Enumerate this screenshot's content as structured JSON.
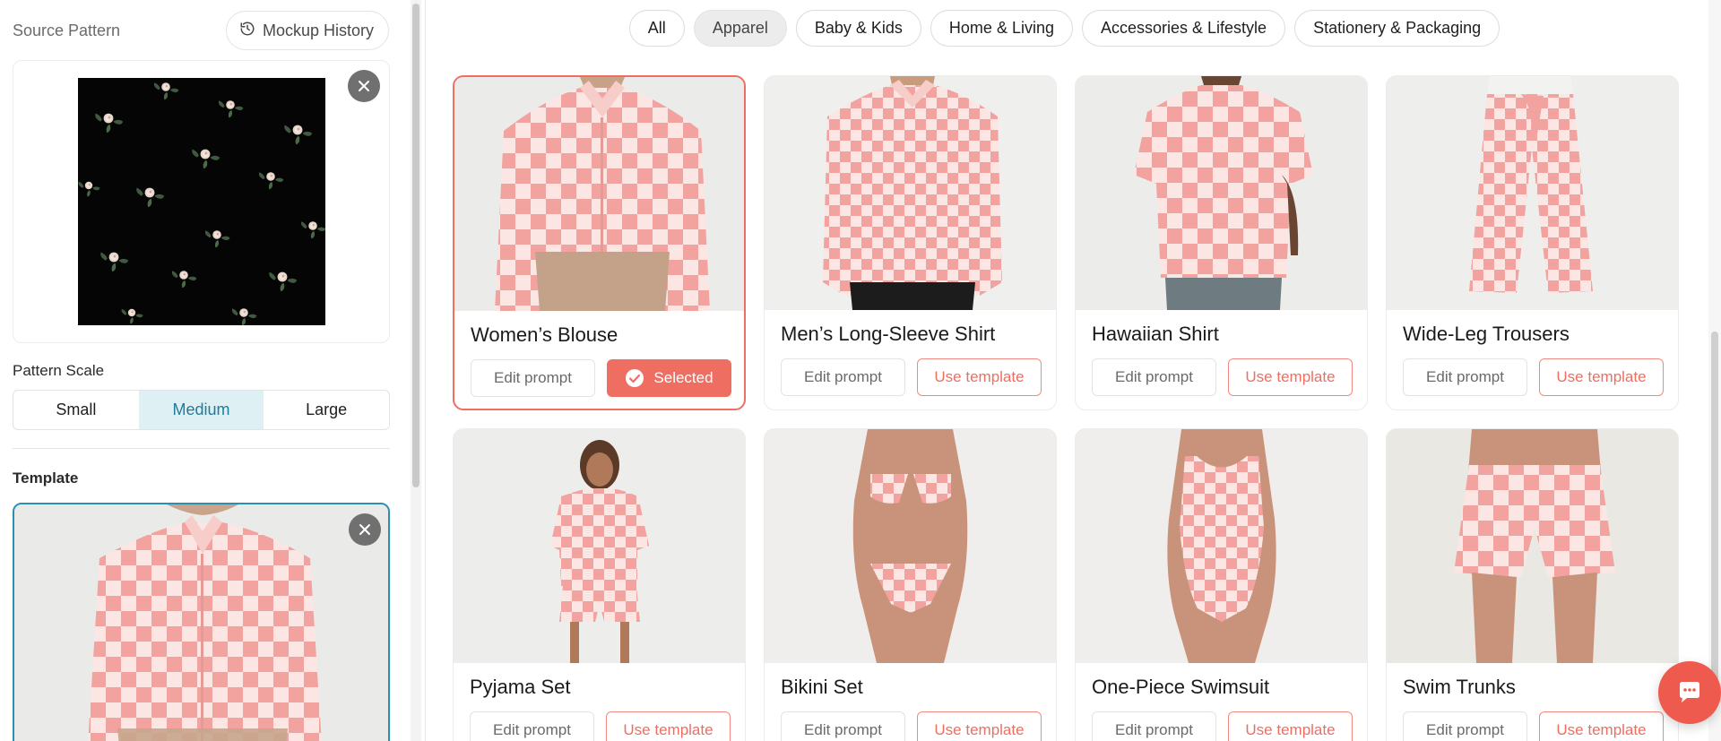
{
  "sidebar": {
    "title": "Source Pattern",
    "history_label": "Mockup History",
    "scale_label": "Pattern Scale",
    "scale_options": [
      "Small",
      "Medium",
      "Large"
    ],
    "scale_selected": "Medium",
    "template_label": "Template"
  },
  "filters": [
    "All",
    "Apparel",
    "Baby & Kids",
    "Home & Living",
    "Accessories & Lifestyle",
    "Stationery & Packaging"
  ],
  "active_filter": "Apparel",
  "templates": [
    {
      "title": "Women’s Blouse",
      "edit_label": "Edit prompt",
      "action_label": "Selected",
      "selected": true
    },
    {
      "title": "Men’s Long-Sleeve Shirt",
      "edit_label": "Edit prompt",
      "action_label": "Use template",
      "selected": false
    },
    {
      "title": "Hawaiian Shirt",
      "edit_label": "Edit prompt",
      "action_label": "Use template",
      "selected": false
    },
    {
      "title": "Wide-Leg Trousers",
      "edit_label": "Edit prompt",
      "action_label": "Use template",
      "selected": false
    },
    {
      "title": "Pyjama Set",
      "edit_label": "Edit prompt",
      "action_label": "Use template",
      "selected": false
    },
    {
      "title": "Bikini Set",
      "edit_label": "Edit prompt",
      "action_label": "Use template",
      "selected": false
    },
    {
      "title": "One-Piece Swimsuit",
      "edit_label": "Edit prompt",
      "action_label": "Use template",
      "selected": false
    },
    {
      "title": "Swim Trunks",
      "edit_label": "Edit prompt",
      "action_label": "Use template",
      "selected": false
    }
  ],
  "colors": {
    "accent": "#ee6e62",
    "selected_teal": "#2a8fb0",
    "check_pink": "#f4a9a6",
    "check_light": "#fbe8e6"
  }
}
